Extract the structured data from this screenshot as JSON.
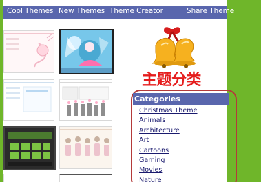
{
  "nav": {
    "items": [
      "Cool Themes",
      "New Themes",
      "Theme Creator",
      "Share Theme"
    ]
  },
  "banner": {
    "title": "主题分类"
  },
  "categories": {
    "heading": "Categories",
    "items": [
      "Christmas Theme",
      "Animals",
      "Architecture",
      "Art",
      "Cartoons",
      "Gaming",
      "Movies",
      "Nature"
    ]
  },
  "colors": {
    "nav_bg": "#5966ad",
    "background_green": "#6fb62a",
    "title_red": "#e51c1c",
    "box_border": "#b43a3a"
  },
  "icons": [
    "bells-icon"
  ]
}
